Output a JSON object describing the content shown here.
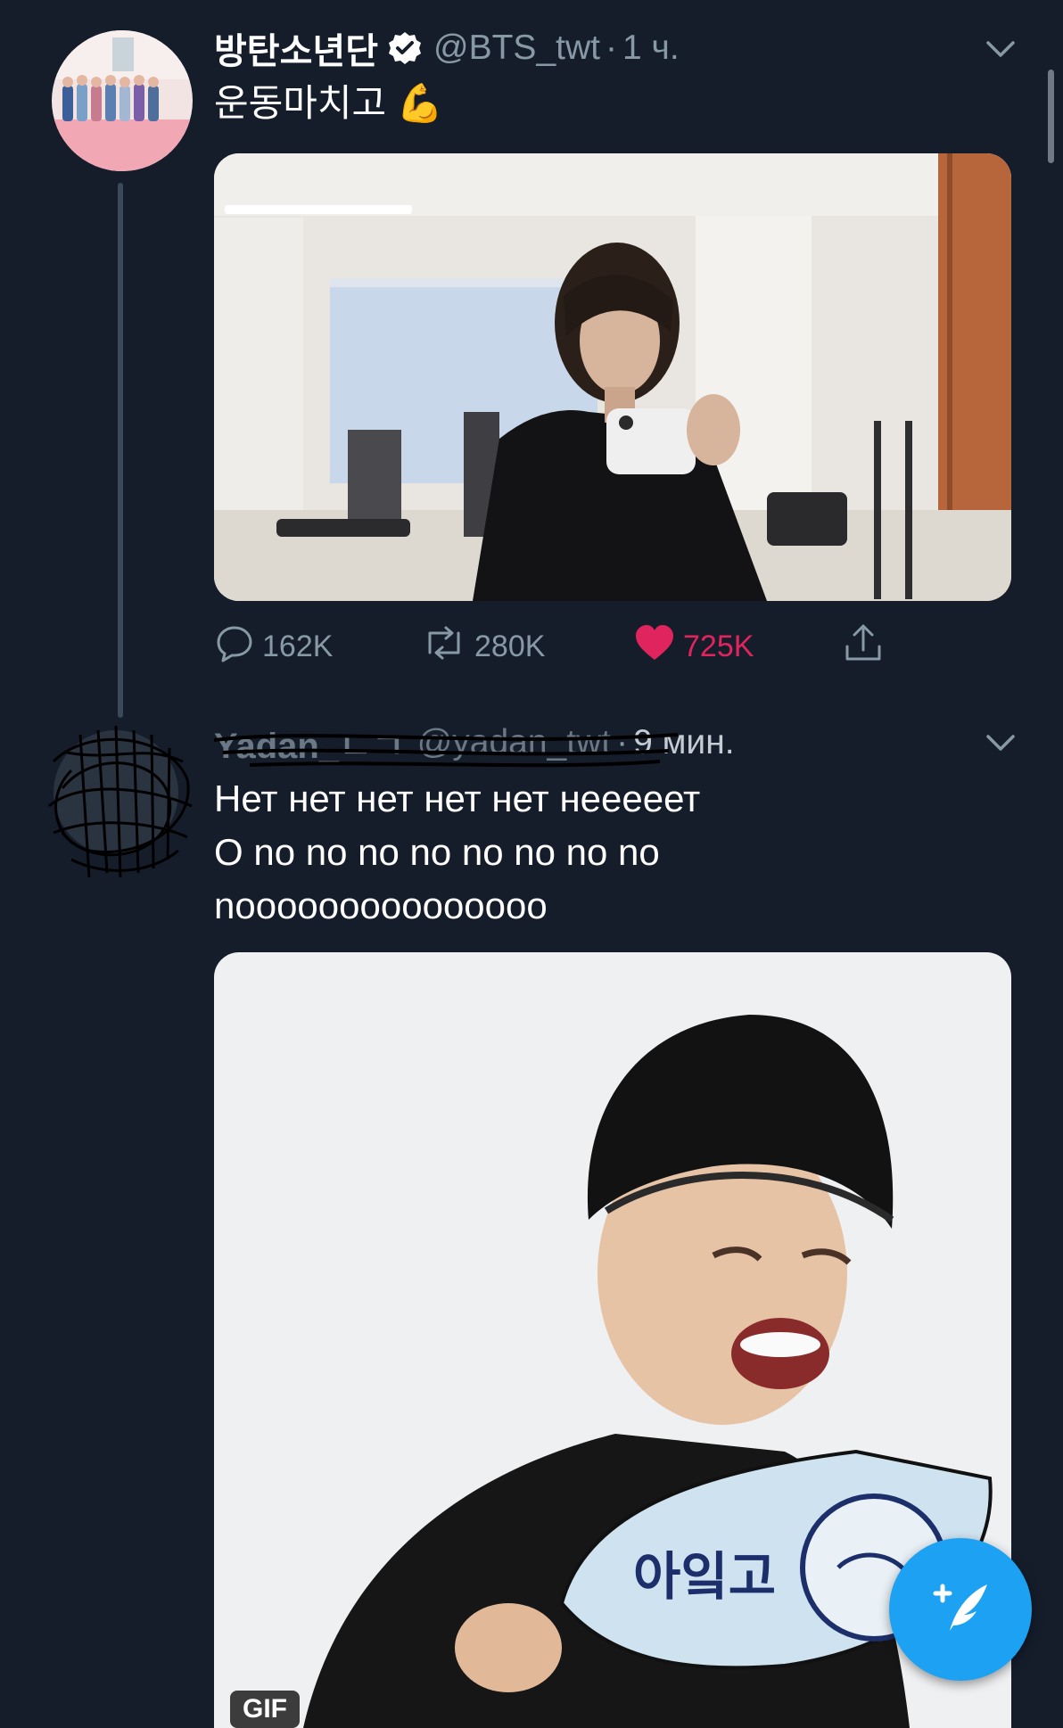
{
  "tweet": {
    "display_name": "방탄소년단",
    "handle": "@BTS_twt",
    "separator": "·",
    "time": "1 ч.",
    "text": "운동마치고 💪",
    "stats": {
      "replies": "162K",
      "retweets": "280K",
      "likes": "725K"
    },
    "liked": true
  },
  "reply": {
    "display_name": "Yadan_ㄴㄱ",
    "handle": "@yadan_twt",
    "separator": "·",
    "time": "9 мин.",
    "lines": [
      "Нет нет нет нет нет неееeет",
      "O no no no no no no no no",
      "nooooooooooooooo"
    ],
    "media_badge": "GIF",
    "sticker_text": "아잌고"
  },
  "colors": {
    "background": "#151d2b",
    "secondary_text": "#8899a6",
    "like": "#e0245e",
    "accent": "#1da1f2"
  },
  "icons": [
    "verified-badge-icon",
    "chevron-down-icon",
    "reply-icon",
    "retweet-icon",
    "heart-icon",
    "share-icon",
    "compose-tweet-icon"
  ]
}
